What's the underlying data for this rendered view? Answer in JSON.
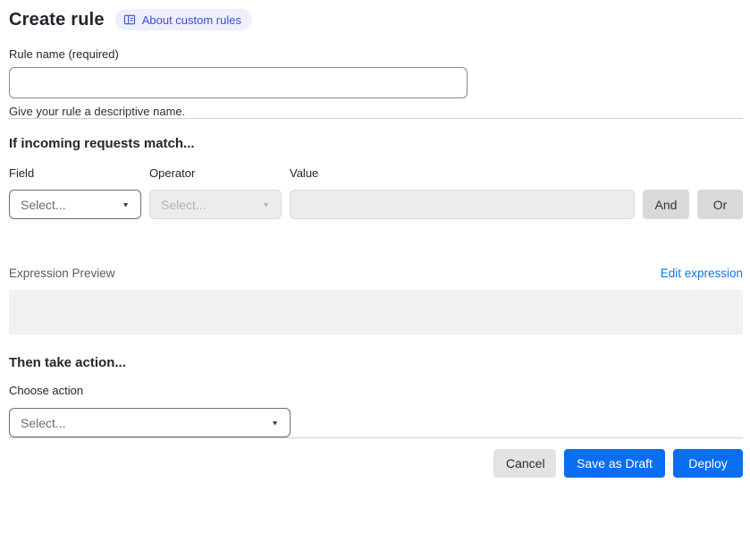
{
  "header": {
    "title": "Create rule",
    "about_link_label": "About custom rules"
  },
  "rule_name": {
    "label": "Rule name (required)",
    "value": "",
    "helper": "Give your rule a descriptive name."
  },
  "match_section": {
    "heading": "If incoming requests match...",
    "field": {
      "label": "Field",
      "selected": "Select..."
    },
    "operator": {
      "label": "Operator",
      "selected": "Select...",
      "disabled": true
    },
    "value": {
      "label": "Value",
      "value": "",
      "disabled": true
    },
    "and_button_label": "And",
    "or_button_label": "Or"
  },
  "expression": {
    "label": "Expression Preview",
    "edit_link_label": "Edit expression",
    "preview_content": ""
  },
  "action_section": {
    "heading": "Then take action...",
    "choose_label": "Choose action",
    "selected": "Select..."
  },
  "footer": {
    "cancel_label": "Cancel",
    "save_draft_label": "Save as Draft",
    "deploy_label": "Deploy"
  },
  "icons": {
    "about_icon": "book-open-icon",
    "caret": "▼"
  },
  "colors": {
    "primary_blue": "#0b6df1",
    "link_blue": "#1672e8",
    "badge_bg": "#edeffb",
    "badge_text": "#3e4ecf",
    "disabled_bg": "#ececec",
    "neutral_button_bg": "#d9d9d9",
    "preview_box_bg": "#f1f1f1"
  }
}
